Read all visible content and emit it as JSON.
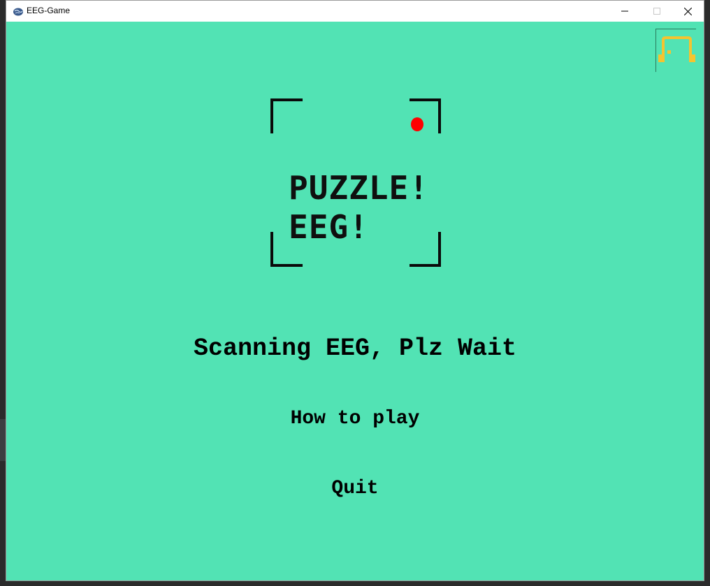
{
  "window": {
    "title": "EEG-Game",
    "icon": "brain-icon",
    "controls": [
      "minimize-icon",
      "maximize-icon",
      "close-icon"
    ]
  },
  "game": {
    "background_color": "#52e3b4",
    "logo": {
      "line1": "PUZZLE!",
      "line2": "EEG!",
      "frame_color": "#000000",
      "dot_color": "#ff0000",
      "icon": "viewfinder-icon"
    },
    "corner_icon": {
      "icon": "headphones-icon",
      "color": "#f4c430"
    },
    "status": "Scanning EEG, Plz Wait",
    "menu": {
      "how_to_play": "How to play",
      "quit": "Quit"
    }
  }
}
